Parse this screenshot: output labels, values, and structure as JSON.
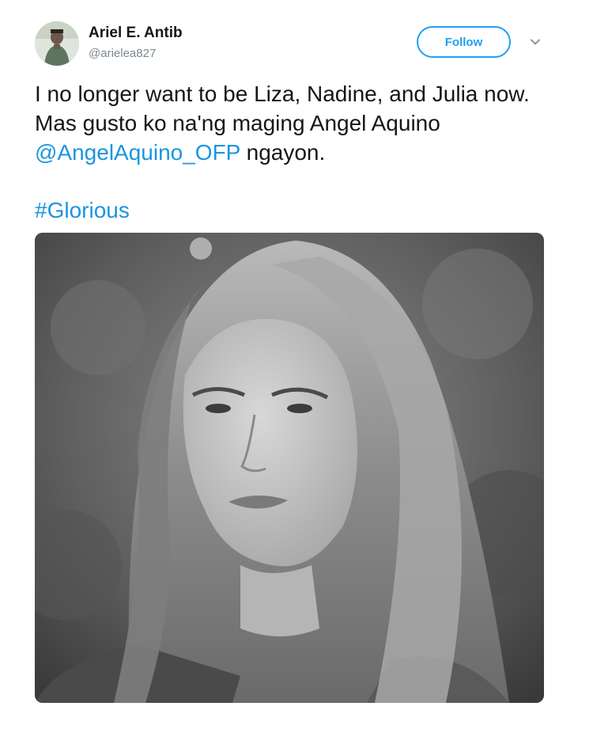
{
  "author": {
    "display_name": "Ariel E. Antib",
    "handle": "@arielea827"
  },
  "follow_button": {
    "label": "Follow"
  },
  "tweet": {
    "text_before_mention": "I no longer want to be Liza, Nadine, and Julia now. Mas gusto ko na'ng maging Angel Aquino ",
    "mention": "@AngelAquino_OFP",
    "text_after_mention": " ngayon.",
    "hashtag": "#Glorious"
  },
  "colors": {
    "link_blue": "#1b95e0",
    "follow_blue": "#1da1f2",
    "handle_gray": "#7b8893"
  },
  "icons": {
    "more_menu": "chevron-down-icon"
  }
}
